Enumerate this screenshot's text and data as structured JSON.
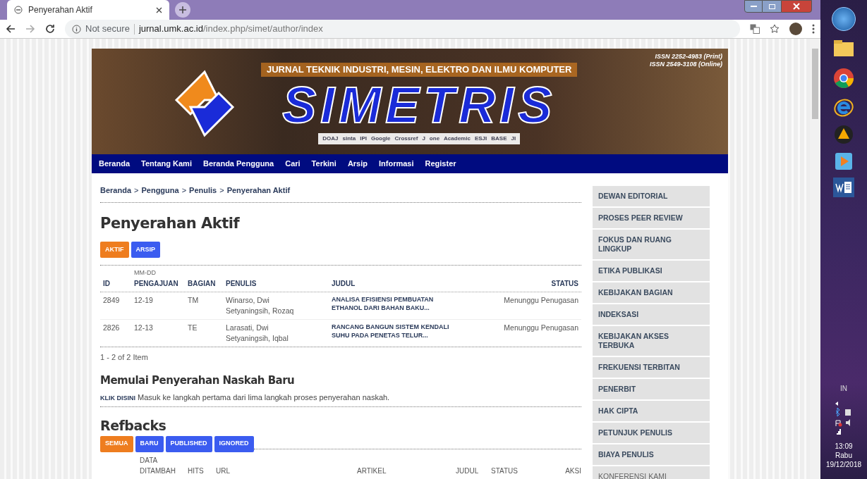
{
  "browser": {
    "tabs": [
      {
        "title": "Penyerahan Aktif",
        "selected": true
      }
    ],
    "security": "Not secure",
    "url_host": "jurnal.umk.ac.id",
    "url_path": "/index.php/simet/author/index"
  },
  "header": {
    "tagline": "JURNAL TEKNIK INDUSTRI, MESIN, ELEKTRO DAN ILMU KOMPUTER",
    "logo_text": "SIMETRIS",
    "issn": [
      "ISSN 2252-4983 (Print)",
      "ISSN 2549-3108 (Online)"
    ],
    "indexers": [
      "DOAJ",
      "sinta",
      "IPI",
      "Google",
      "Crossref",
      "J",
      "one",
      "Academic",
      "ESJI",
      "BASE",
      "JI"
    ]
  },
  "nav": [
    "Beranda",
    "Tentang Kami",
    "Beranda Pengguna",
    "Cari",
    "Terkini",
    "Arsip",
    "Informasi",
    "Register"
  ],
  "breadcrumb": [
    {
      "kind": "link",
      "text": "Beranda"
    },
    {
      "kind": "separator",
      "text": ">"
    },
    {
      "kind": "link",
      "text": "Pengguna"
    },
    {
      "kind": "separator",
      "text": ">"
    },
    {
      "kind": "link",
      "text": "Penulis"
    },
    {
      "kind": "separator",
      "text": ">"
    },
    {
      "kind": "link",
      "text": "Penyerahan Aktif"
    }
  ],
  "title": "Penyerahan Aktif",
  "filters": [
    {
      "label": "AKTIF",
      "selected": true
    },
    {
      "label": "ARSIP",
      "selected": false
    }
  ],
  "table": {
    "columns": [
      {
        "label": "ID"
      },
      {
        "top": "MM-DD",
        "label": "PENGAJUAN"
      },
      {
        "label": "BAGIAN"
      },
      {
        "label": "PENULIS"
      },
      {
        "label": "JUDUL"
      },
      {
        "label": "STATUS"
      }
    ],
    "rows": [
      {
        "id": "2849",
        "date": "12-19",
        "section": "TM",
        "authors": "Winarso, Dwi Setyaningsih, Rozaq",
        "title": "ANALISA EFISIENSI PEMBUATAN ETHANOL DARI BAHAN BAKU...",
        "status": "Menunggu Penugasan"
      },
      {
        "id": "2826",
        "date": "12-13",
        "section": "TE",
        "authors": "Larasati, Dwi Setyaningsih, Iqbal",
        "title": "RANCANG BANGUN SISTEM KENDALI SUHU PADA PENETAS TELUR...",
        "status": "Menunggu Penugasan"
      }
    ],
    "count": "1 - 2 of 2 Item"
  },
  "new_submission": {
    "heading": "Memulai Penyerahan Naskah Baru",
    "link": "KLIK DISINI",
    "text": "Masuk ke langkah pertama dari lima langkah proses penyerahan naskah."
  },
  "refbacks": {
    "heading": "Refbacks",
    "filters": [
      {
        "label": "SEMUA",
        "selected": true
      },
      {
        "label": "BARU",
        "selected": false
      },
      {
        "label": "PUBLISHED",
        "selected": false
      },
      {
        "label": "IGNORED",
        "selected": false
      }
    ],
    "columns": [
      {
        "top": "DATA",
        "label": "DITAMBAH"
      },
      {
        "label": "HITS"
      },
      {
        "label": "URL"
      },
      {
        "label": "ARTIKEL"
      },
      {
        "label": "JUDUL"
      },
      {
        "label": "STATUS"
      },
      {
        "label": "AKSI"
      }
    ]
  },
  "sidebar": [
    {
      "label": "DEWAN EDITORIAL",
      "bold": true
    },
    {
      "label": "PROSES PEER REVIEW",
      "bold": true
    },
    {
      "label": "FOKUS DAN RUANG LINGKUP",
      "bold": true
    },
    {
      "label": "ETIKA PUBLIKASI",
      "bold": true
    },
    {
      "label": "KEBIJAKAN BAGIAN",
      "bold": true
    },
    {
      "label": "INDEKSASI",
      "bold": true
    },
    {
      "label": "KEBIJAKAN AKSES TERBUKA",
      "bold": true
    },
    {
      "label": "FREKUENSI TERBITAN",
      "bold": true
    },
    {
      "label": "PENERBIT",
      "bold": true
    },
    {
      "label": "HAK CIPTA",
      "bold": true
    },
    {
      "label": "PETUNJUK PENULIS",
      "bold": true
    },
    {
      "label": "BIAYA PENULIS",
      "bold": true
    },
    {
      "label": "KONFERENSI KAMI",
      "bold": false
    }
  ],
  "taskbar": {
    "language": "IN",
    "time": "13:09",
    "day": "Rabu",
    "date": "19/12/2018"
  }
}
